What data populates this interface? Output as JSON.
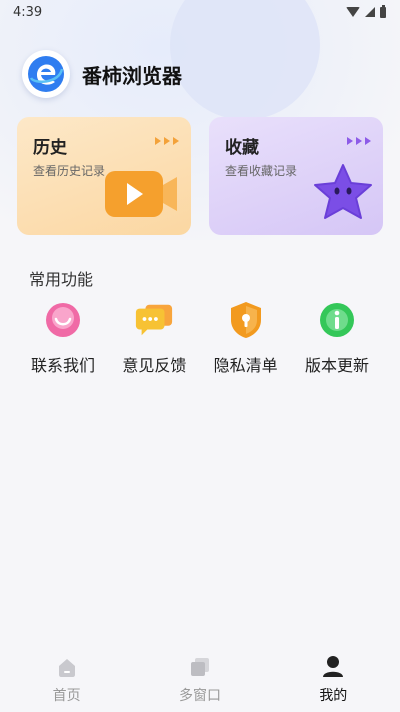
{
  "status_bar": {
    "time": "4:39"
  },
  "header": {
    "app_title": "番柿浏览器"
  },
  "cards": {
    "history": {
      "title": "历史",
      "subtitle": "查看历史记录"
    },
    "favorites": {
      "title": "收藏",
      "subtitle": "查看收藏记录"
    }
  },
  "common": {
    "section_title": "常用功能",
    "items": [
      {
        "label": "联系我们",
        "icon": "chat-bubble-smile-icon"
      },
      {
        "label": "意见反馈",
        "icon": "feedback-bubble-icon"
      },
      {
        "label": "隐私清单",
        "icon": "shield-lock-icon"
      },
      {
        "label": "版本更新",
        "icon": "info-icon"
      }
    ]
  },
  "bottom_nav": {
    "items": [
      {
        "label": "首页"
      },
      {
        "label": "多窗口"
      },
      {
        "label": "我的"
      }
    ],
    "active": "我的"
  },
  "colors": {
    "history_accent": "#f5a02d",
    "favorites_accent": "#7b4ee6",
    "contact_pink": "#f06aa6",
    "feedback_yellow": "#f7c234",
    "privacy_orange": "#f29a1f",
    "update_green": "#34c759"
  }
}
